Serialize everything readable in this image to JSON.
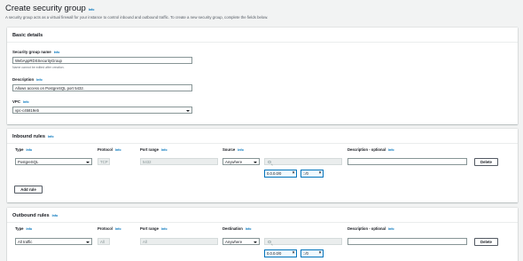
{
  "page": {
    "title": "Create security group",
    "title_info": "Info",
    "description": "A security group acts as a virtual firewall for your instance to control inbound and outbound traffic. To create a new security group, complete the fields below."
  },
  "basic": {
    "heading": "Basic details",
    "name_label": "Security group name",
    "name_info": "Info",
    "name_value": "WebAppRDSSecurityGroup",
    "name_hint": "Name cannot be edited after creation.",
    "desc_label": "Description",
    "desc_info": "Info",
    "desc_value": "Allows access on PostgreSQL port 5432.",
    "vpc_label": "VPC",
    "vpc_info": "Info",
    "vpc_value": "vpc-c45819eb"
  },
  "inbound": {
    "heading": "Inbound rules",
    "heading_info": "Info",
    "columns": [
      {
        "label": "Type",
        "info": "Info"
      },
      {
        "label": "Protocol",
        "info": "Info"
      },
      {
        "label": "Port range",
        "info": "Info"
      },
      {
        "label": "Source",
        "info": "Info"
      },
      {
        "label": "Description - optional",
        "info": "Info"
      }
    ],
    "row": {
      "type": "PostgreSQL",
      "protocol": "TCP",
      "port": "5432",
      "source": "Anywhere",
      "tokens": [
        "0.0.0.0/0",
        "::/0"
      ],
      "delete_label": "Delete"
    },
    "add_rule_label": "Add rule"
  },
  "outbound": {
    "heading": "Outbound rules",
    "heading_info": "Info",
    "columns": [
      {
        "label": "Type",
        "info": "Info"
      },
      {
        "label": "Protocol",
        "info": "Info"
      },
      {
        "label": "Port range",
        "info": "Info"
      },
      {
        "label": "Destination",
        "info": "Info"
      },
      {
        "label": "Description - optional",
        "info": "Info"
      }
    ],
    "row": {
      "type": "All traffic",
      "protocol": "All",
      "port": "All",
      "destination": "Anywhere",
      "tokens": [
        "0.0.0.0/0",
        "::/0"
      ],
      "delete_label": "Delete"
    }
  }
}
